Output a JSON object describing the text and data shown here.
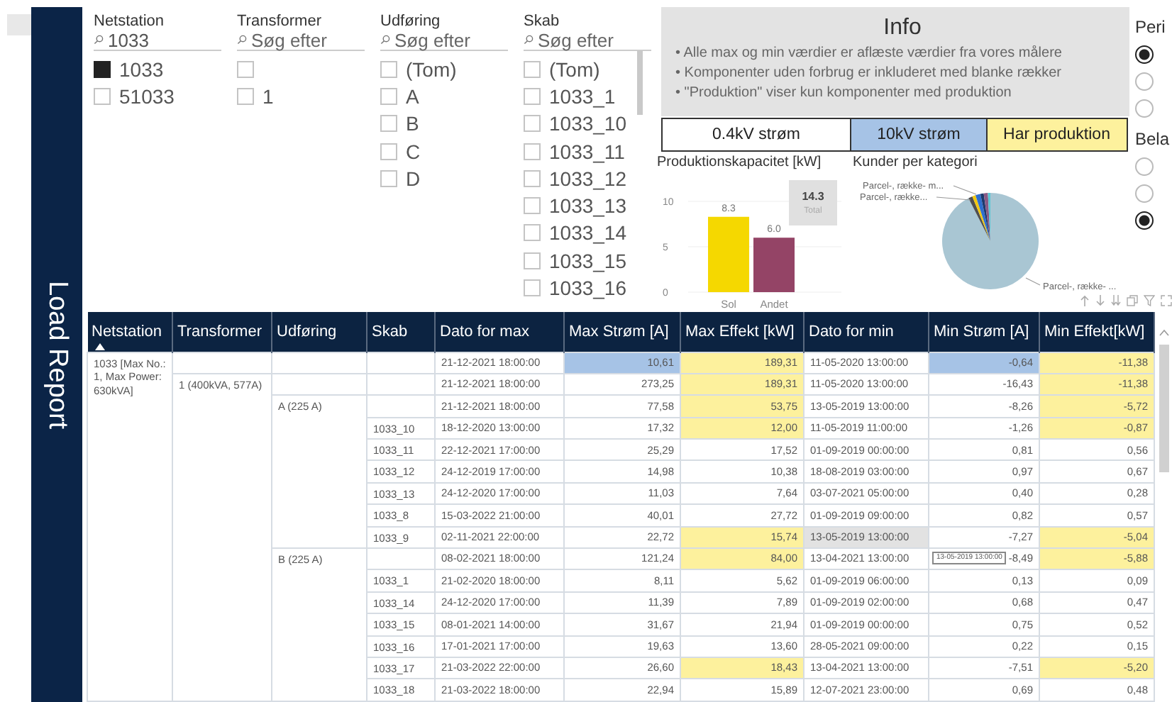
{
  "sidebar": {
    "title": "Load Report"
  },
  "slicers": [
    {
      "title": "Netstation",
      "search": {
        "value": "1033"
      },
      "items": [
        {
          "label": "1033",
          "checked": true
        },
        {
          "label": "51033",
          "checked": false
        }
      ]
    },
    {
      "title": "Transformer",
      "search": {
        "placeholder": "Søg efter"
      },
      "items": [
        {
          "checked": false
        },
        {
          "label": "1",
          "checked": false
        }
      ]
    },
    {
      "title": "Udføring",
      "search": {
        "placeholder": "Søg efter"
      },
      "items": [
        {
          "label": "(Tom)",
          "checked": false
        },
        {
          "label": "A",
          "checked": false
        },
        {
          "label": "B",
          "checked": false
        },
        {
          "label": "C",
          "checked": false
        },
        {
          "label": "D",
          "checked": false
        }
      ]
    },
    {
      "title": "Skab",
      "search": {
        "placeholder": "Søg efter"
      },
      "items": [
        {
          "label": "(Tom)",
          "checked": false
        },
        {
          "label": "1033_1",
          "checked": false
        },
        {
          "label": "1033_10",
          "checked": false
        },
        {
          "label": "1033_11",
          "checked": false
        },
        {
          "label": "1033_12",
          "checked": false
        },
        {
          "label": "1033_13",
          "checked": false
        },
        {
          "label": "1033_14",
          "checked": false
        },
        {
          "label": "1033_15",
          "checked": false
        },
        {
          "label": "1033_16",
          "checked": false
        }
      ]
    }
  ],
  "info": {
    "title": "Info",
    "lines": [
      "• Alle max og min værdier er aflæste værdier fra vores målere",
      "• Komponenter uden forbrug er inkluderet med blanke rækker",
      "• \"Produktion\" viser kun komponenter med produktion"
    ]
  },
  "legend": [
    {
      "label": "0.4kV strøm",
      "kind": "lowvoltage"
    },
    {
      "label": "10kV strøm",
      "kind": "highvoltage"
    },
    {
      "label": "Har produktion",
      "kind": "production"
    }
  ],
  "bar_chart": {
    "total_card": {
      "value": "14.3",
      "label": "Total"
    },
    "chart_data": {
      "type": "bar",
      "title": "Produktionskapacitet [kW]",
      "ylim": [
        0,
        10
      ],
      "yticks": [
        0,
        5,
        10
      ],
      "value_labels": [
        "8.3",
        "6.0"
      ],
      "series": [
        {
          "name": "Sol",
          "color": "#f5d800",
          "values": [
            8.3
          ]
        },
        {
          "name": "Andet",
          "color": "#944466",
          "values": [
            6.0
          ]
        }
      ]
    }
  },
  "pie_chart": {
    "title": "Kunder per kategori",
    "labels": [
      "Parcel-, række- m...",
      "Parcel-, række...",
      "Parcel-, række- ..."
    ]
  },
  "right_panel": [
    {
      "title": "Peri",
      "options": [
        {
          "selected": true
        },
        {
          "selected": false
        },
        {
          "selected": false
        }
      ]
    },
    {
      "title": "Bela",
      "options": [
        {
          "selected": false
        },
        {
          "selected": false
        },
        {
          "selected": true
        }
      ]
    }
  ],
  "table": {
    "columns": [
      {
        "label": "Netstation",
        "sorted": true
      },
      {
        "label": "Transformer",
        "sorted": false
      },
      {
        "label": "Udføring",
        "sorted": false
      },
      {
        "label": "Skab",
        "sorted": false
      },
      {
        "label": "Dato for max",
        "sorted": false
      },
      {
        "label": "Max Strøm [A]",
        "sorted": false
      },
      {
        "label": "Max Effekt [kW]",
        "sorted": false
      },
      {
        "label": "Dato for min",
        "sorted": false
      },
      {
        "label": "Min Strøm [A]",
        "sorted": false
      },
      {
        "label": "Min Effekt[kW]",
        "sorted": false
      }
    ],
    "rows": [
      {
        "cells": [
          {
            "text": "1033 [Max No.: 1, Max Power: 630kVA]",
            "kind": "plain",
            "rowspan": 16
          },
          {
            "text": "",
            "kind": "plain"
          },
          {
            "text": "",
            "kind": "plain"
          },
          {
            "text": "",
            "kind": "plain"
          },
          {
            "text": "21-12-2021 18:00:00",
            "kind": "plain"
          },
          {
            "text": "10,61",
            "kind": "highvoltage"
          },
          {
            "text": "189,31",
            "kind": "production"
          },
          {
            "text": "11-05-2020 13:00:00",
            "kind": "plain"
          },
          {
            "text": "-0,64",
            "kind": "highvoltage"
          },
          {
            "text": "-11,38",
            "kind": "production"
          }
        ]
      },
      {
        "cells": [
          {
            "text": "1 (400kVA, 577A)",
            "kind": "plain",
            "rowspan": 15
          },
          {
            "text": "",
            "kind": "plain"
          },
          {
            "text": "",
            "kind": "plain"
          },
          {
            "text": "21-12-2021 18:00:00",
            "kind": "plain"
          },
          {
            "text": "273,25",
            "kind": "plain"
          },
          {
            "text": "189,31",
            "kind": "production"
          },
          {
            "text": "11-05-2020 13:00:00",
            "kind": "plain"
          },
          {
            "text": "-16,43",
            "kind": "plain"
          },
          {
            "text": "-11,38",
            "kind": "production"
          }
        ]
      },
      {
        "cells": [
          {
            "text": "A (225 A)",
            "kind": "plain",
            "rowspan": 7
          },
          {
            "text": "",
            "kind": "plain"
          },
          {
            "text": "21-12-2021 18:00:00",
            "kind": "plain"
          },
          {
            "text": "77,58",
            "kind": "plain"
          },
          {
            "text": "53,75",
            "kind": "production"
          },
          {
            "text": "13-05-2019 13:00:00",
            "kind": "plain"
          },
          {
            "text": "-8,26",
            "kind": "plain"
          },
          {
            "text": "-5,72",
            "kind": "production"
          }
        ]
      },
      {
        "cells": [
          {
            "text": "1033_10",
            "kind": "plain"
          },
          {
            "text": "18-12-2020 13:00:00",
            "kind": "plain"
          },
          {
            "text": "17,32",
            "kind": "plain"
          },
          {
            "text": "12,00",
            "kind": "production"
          },
          {
            "text": "11-05-2019 11:00:00",
            "kind": "plain"
          },
          {
            "text": "-1,26",
            "kind": "plain"
          },
          {
            "text": "-0,87",
            "kind": "production"
          }
        ]
      },
      {
        "cells": [
          {
            "text": "1033_11",
            "kind": "plain"
          },
          {
            "text": "22-12-2021 17:00:00",
            "kind": "plain"
          },
          {
            "text": "25,29",
            "kind": "plain"
          },
          {
            "text": "17,52",
            "kind": "plain"
          },
          {
            "text": "01-09-2019 00:00:00",
            "kind": "plain"
          },
          {
            "text": "0,81",
            "kind": "plain"
          },
          {
            "text": "0,56",
            "kind": "plain"
          }
        ]
      },
      {
        "cells": [
          {
            "text": "1033_12",
            "kind": "plain"
          },
          {
            "text": "24-12-2019 17:00:00",
            "kind": "plain"
          },
          {
            "text": "14,98",
            "kind": "plain"
          },
          {
            "text": "10,38",
            "kind": "plain"
          },
          {
            "text": "18-08-2019 03:00:00",
            "kind": "plain"
          },
          {
            "text": "0,97",
            "kind": "plain"
          },
          {
            "text": "0,67",
            "kind": "plain"
          }
        ]
      },
      {
        "cells": [
          {
            "text": "1033_13",
            "kind": "plain"
          },
          {
            "text": "24-12-2020 17:00:00",
            "kind": "plain"
          },
          {
            "text": "11,03",
            "kind": "plain"
          },
          {
            "text": "7,64",
            "kind": "plain"
          },
          {
            "text": "03-07-2021 05:00:00",
            "kind": "plain"
          },
          {
            "text": "0,40",
            "kind": "plain"
          },
          {
            "text": "0,28",
            "kind": "plain"
          }
        ]
      },
      {
        "cells": [
          {
            "text": "1033_8",
            "kind": "plain"
          },
          {
            "text": "15-03-2022 21:00:00",
            "kind": "plain"
          },
          {
            "text": "40,01",
            "kind": "plain"
          },
          {
            "text": "27,72",
            "kind": "plain"
          },
          {
            "text": "01-09-2019 09:00:00",
            "kind": "plain"
          },
          {
            "text": "0,82",
            "kind": "plain"
          },
          {
            "text": "0,57",
            "kind": "plain"
          }
        ]
      },
      {
        "cells": [
          {
            "text": "1033_9",
            "kind": "plain"
          },
          {
            "text": "02-11-2021 22:00:00",
            "kind": "plain"
          },
          {
            "text": "22,72",
            "kind": "plain"
          },
          {
            "text": "15,74",
            "kind": "production"
          },
          {
            "text": "13-05-2019 13:00:00",
            "kind": "hover"
          },
          {
            "text": "-7,27",
            "kind": "plain"
          },
          {
            "text": "-5,04",
            "kind": "production"
          }
        ]
      },
      {
        "cells": [
          {
            "text": "B (225 A)",
            "kind": "plain",
            "rowspan": 7
          },
          {
            "text": "",
            "kind": "plain"
          },
          {
            "text": "08-02-2021 18:00:00",
            "kind": "plain"
          },
          {
            "text": "121,24",
            "kind": "plain"
          },
          {
            "text": "84,00",
            "kind": "production"
          },
          {
            "text": "13-04-2021 13:00:00",
            "kind": "plain"
          },
          {
            "text": "-8,49",
            "kind": "plain",
            "tooltip": "13-05-2019 13:00:00"
          },
          {
            "text": "-5,88",
            "kind": "production"
          }
        ]
      },
      {
        "cells": [
          {
            "text": "1033_1",
            "kind": "plain"
          },
          {
            "text": "21-02-2020 18:00:00",
            "kind": "plain"
          },
          {
            "text": "8,11",
            "kind": "plain"
          },
          {
            "text": "5,62",
            "kind": "plain"
          },
          {
            "text": "01-09-2019 06:00:00",
            "kind": "plain"
          },
          {
            "text": "0,13",
            "kind": "plain"
          },
          {
            "text": "0,09",
            "kind": "plain"
          }
        ]
      },
      {
        "cells": [
          {
            "text": "1033_14",
            "kind": "plain"
          },
          {
            "text": "24-12-2020 17:00:00",
            "kind": "plain"
          },
          {
            "text": "11,39",
            "kind": "plain"
          },
          {
            "text": "7,89",
            "kind": "plain"
          },
          {
            "text": "01-09-2019 02:00:00",
            "kind": "plain"
          },
          {
            "text": "0,68",
            "kind": "plain"
          },
          {
            "text": "0,47",
            "kind": "plain"
          }
        ]
      },
      {
        "cells": [
          {
            "text": "1033_15",
            "kind": "plain"
          },
          {
            "text": "08-01-2021 14:00:00",
            "kind": "plain"
          },
          {
            "text": "31,67",
            "kind": "plain"
          },
          {
            "text": "21,94",
            "kind": "plain"
          },
          {
            "text": "01-09-2019 00:00:00",
            "kind": "plain"
          },
          {
            "text": "0,75",
            "kind": "plain"
          },
          {
            "text": "0,52",
            "kind": "plain"
          }
        ]
      },
      {
        "cells": [
          {
            "text": "1033_16",
            "kind": "plain"
          },
          {
            "text": "17-01-2021 17:00:00",
            "kind": "plain"
          },
          {
            "text": "19,63",
            "kind": "plain"
          },
          {
            "text": "13,60",
            "kind": "plain"
          },
          {
            "text": "28-05-2021 09:00:00",
            "kind": "plain"
          },
          {
            "text": "0,22",
            "kind": "plain"
          },
          {
            "text": "0,15",
            "kind": "plain"
          }
        ]
      },
      {
        "cells": [
          {
            "text": "1033_17",
            "kind": "plain"
          },
          {
            "text": "21-03-2022 22:00:00",
            "kind": "plain"
          },
          {
            "text": "26,60",
            "kind": "plain"
          },
          {
            "text": "18,43",
            "kind": "production"
          },
          {
            "text": "13-04-2021 13:00:00",
            "kind": "plain"
          },
          {
            "text": "-7,51",
            "kind": "plain"
          },
          {
            "text": "-5,20",
            "kind": "production"
          }
        ]
      },
      {
        "cells": [
          {
            "text": "1033_18",
            "kind": "plain"
          },
          {
            "text": "21-03-2022 18:00:00",
            "kind": "plain"
          },
          {
            "text": "22,94",
            "kind": "plain"
          },
          {
            "text": "15,89",
            "kind": "plain"
          },
          {
            "text": "12-07-2021 23:00:00",
            "kind": "plain"
          },
          {
            "text": "0,69",
            "kind": "plain"
          },
          {
            "text": "0,48",
            "kind": "plain"
          }
        ]
      }
    ]
  }
}
